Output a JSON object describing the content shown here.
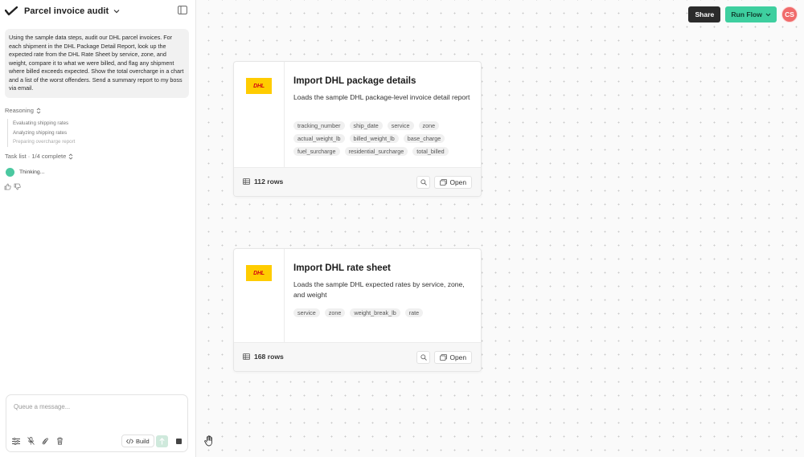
{
  "sidebar": {
    "title": "Parcel invoice audit",
    "prompt": "Using the sample data steps, audit our DHL parcel invoices. For each shipment in the DHL Package Detail Report, look up the expected rate from the DHL Rate Sheet by service, zone, and weight, compare it to what we were billed, and flag any shipment where billed exceeds expected. Show the total overcharge in a chart and a list of the worst offenders. Send a summary report to my boss via email.",
    "reasoning_label": "Reasoning",
    "reasoning_items": [
      "Evaluating shipping rates",
      "Analyzing shipping rates",
      "Preparing overcharge report"
    ],
    "task_list_label": "Task list · 1/4 complete",
    "thinking_label": "Thinking...",
    "composer_placeholder": "Queue a message...",
    "build_label": "Build"
  },
  "header": {
    "share_label": "Share",
    "run_label": "Run Flow",
    "avatar_initials": "CS"
  },
  "cards": [
    {
      "logo_text": "DHL",
      "title": "Import DHL package details",
      "description": "Loads the sample DHL package-level invoice detail report",
      "tags": [
        "tracking_number",
        "ship_date",
        "service",
        "zone",
        "actual_weight_lb",
        "billed_weight_lb",
        "base_charge",
        "fuel_surcharge",
        "residential_surcharge",
        "total_billed"
      ],
      "rows": "112 rows",
      "open_label": "Open"
    },
    {
      "logo_text": "DHL",
      "title": "Import DHL rate sheet",
      "description": "Loads the sample DHL expected rates by service, zone, and weight",
      "tags": [
        "service",
        "zone",
        "weight_break_lb",
        "rate"
      ],
      "rows": "168 rows",
      "open_label": "Open"
    }
  ],
  "colors": {
    "accent_green": "#3ecf9f",
    "dhl_yellow": "#ffcc00",
    "dhl_red": "#d40511",
    "avatar_red": "#f06a6a"
  }
}
